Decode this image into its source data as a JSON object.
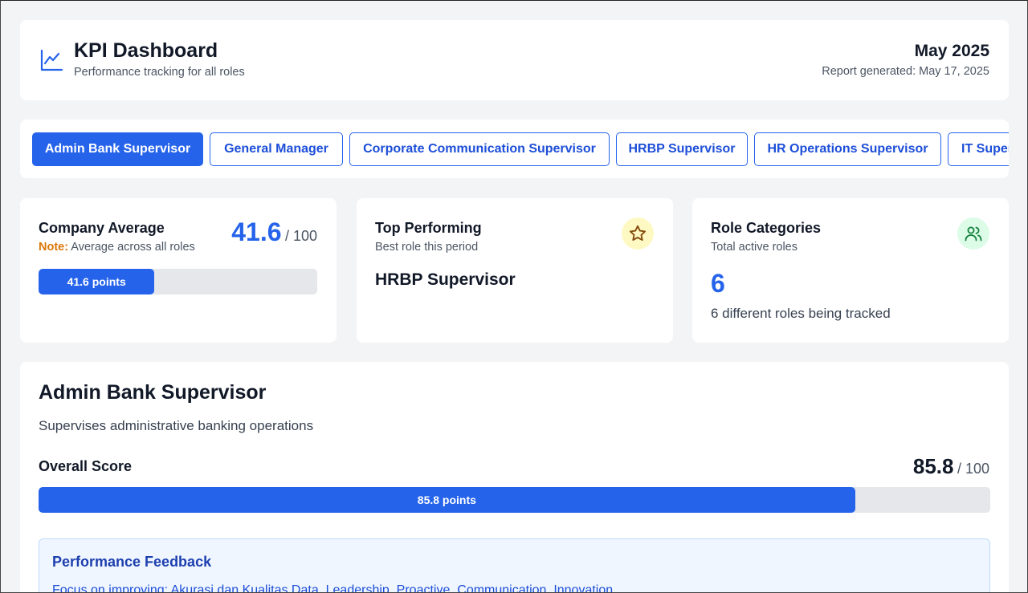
{
  "header": {
    "title": "KPI Dashboard",
    "subtitle": "Performance tracking for all roles",
    "period": "May 2025",
    "generated": "Report generated: May 17, 2025",
    "icon": "chart-line-icon"
  },
  "tabs": [
    {
      "label": "Admin Bank Supervisor",
      "active": true
    },
    {
      "label": "General Manager",
      "active": false
    },
    {
      "label": "Corporate Communication Supervisor",
      "active": false
    },
    {
      "label": "HRBP Supervisor",
      "active": false
    },
    {
      "label": "HR Operations Supervisor",
      "active": false
    },
    {
      "label": "IT Super",
      "active": false
    }
  ],
  "company_average": {
    "title": "Company Average",
    "note_label": "Note:",
    "note_text": " Average across all roles",
    "score": "41.6",
    "max": "/ 100",
    "progress": 0.416,
    "bar_label": "41.6 points"
  },
  "top_performing": {
    "title": "Top Performing",
    "subtitle": "Best role this period",
    "role": "HRBP Supervisor",
    "icon": "star-icon",
    "icon_bg": "#fef9c3",
    "icon_color": "#854d0e"
  },
  "role_categories": {
    "title": "Role Categories",
    "subtitle": "Total active roles",
    "count": "6",
    "description": "6 different roles being tracked",
    "icon": "users-icon",
    "icon_bg": "#dcfce7",
    "icon_color": "#15803d"
  },
  "detail": {
    "title": "Admin Bank Supervisor",
    "description": "Supervises administrative banking operations",
    "overall_label": "Overall Score",
    "score": "85.8",
    "max": "/ 100",
    "progress": 0.858,
    "bar_label": "85.8 points"
  },
  "feedback": {
    "title": "Performance Feedback",
    "text": "Focus on improving: Akurasi dan Kualitas Data, Leadership, Proactive, Communication, Innovation"
  },
  "colors": {
    "accent": "#2563eb",
    "track": "#e5e7eb",
    "note": "#d97706"
  }
}
